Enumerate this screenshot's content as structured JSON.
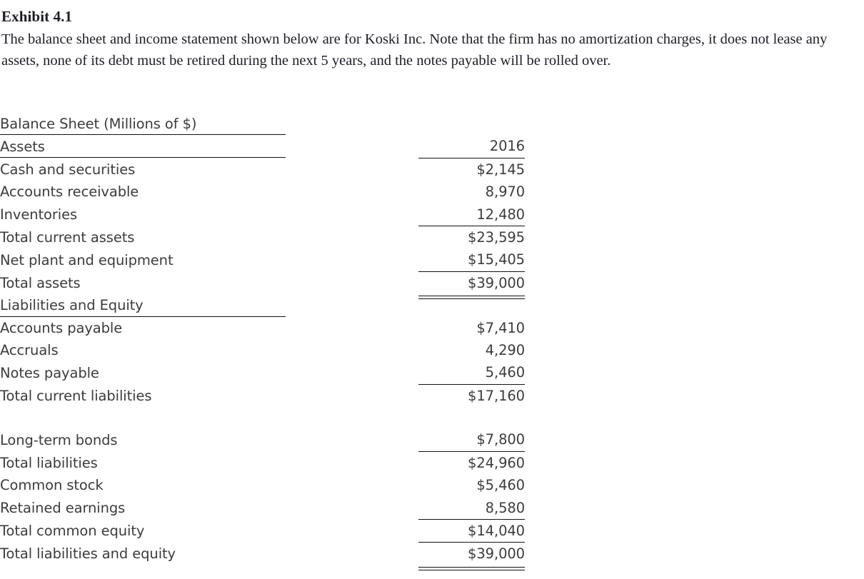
{
  "header": {
    "exhibit_title": "Exhibit 4.1",
    "description": "The balance sheet and income statement shown below are for Koski Inc. Note that the firm has no amortization charges, it does not lease any assets, none of its debt must be retired during the next 5 years, and the notes payable will be rolled over."
  },
  "statement": {
    "title": "Balance Sheet (Millions of $)",
    "section_assets_label": "Assets",
    "section_liabilities_label": "Liabilities and Equity",
    "year_column_header": "2016",
    "rows": [
      {
        "label": "Cash and securities",
        "value": "$2,145"
      },
      {
        "label": "Accounts receivable",
        "value": "8,970"
      },
      {
        "label": "Inventories",
        "value": "12,480"
      },
      {
        "label": "Total current assets",
        "value": "$23,595"
      },
      {
        "label": "Net plant and equipment",
        "value": "$15,405"
      },
      {
        "label": "Total assets",
        "value": "$39,000"
      },
      {
        "label": "Accounts payable",
        "value": "$7,410"
      },
      {
        "label": "Accruals",
        "value": "4,290"
      },
      {
        "label": "Notes payable",
        "value": "5,460"
      },
      {
        "label": "Total current liabilities",
        "value": "$17,160"
      },
      {
        "label": "Long-term bonds",
        "value": "$7,800"
      },
      {
        "label": "Total liabilities",
        "value": "$24,960"
      },
      {
        "label": "Common stock",
        "value": "$5,460"
      },
      {
        "label": "Retained earnings",
        "value": "8,580"
      },
      {
        "label": "Total common equity",
        "value": "$14,040"
      },
      {
        "label": "Total liabilities and equity",
        "value": "$39,000"
      }
    ]
  },
  "colors": {
    "page_background": "#ffffff",
    "body_text": "#3c3c3c",
    "heading_text": "#1d1d28",
    "rule": "#121212"
  }
}
